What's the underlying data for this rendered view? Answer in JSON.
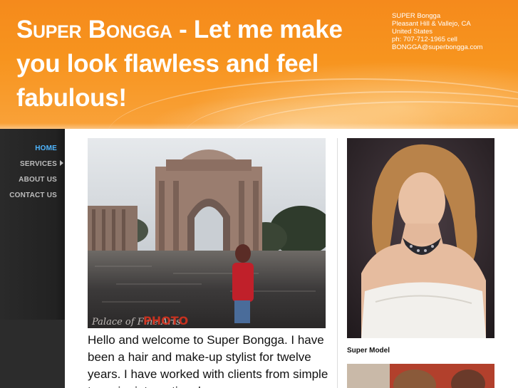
{
  "header": {
    "title_smallcaps": "Super Bongga",
    "title_rest": " - Let me make you look flawless and feel fabulous!",
    "contact": {
      "name": "SUPER Bongga",
      "location": "Pleasant Hill & Vallejo, CA",
      "country": "United States",
      "phone": "ph: 707-712-1965 cell",
      "email": "BONGGA@superbongga.com"
    }
  },
  "nav": {
    "items": [
      {
        "label": "HOME",
        "active": true
      },
      {
        "label": "SERVICES",
        "has_submenu": true
      },
      {
        "label": "ABOUT US"
      },
      {
        "label": "CONTACT US"
      }
    ]
  },
  "main": {
    "photo_watermark": "Palace of Fine Arts",
    "photo_credit": "PHOTO",
    "intro_text": "Hello and welcome to Super Bongga.  I have been a hair and make-up stylist for twelve years.  I have worked with clients from simple to major international"
  },
  "sidebar_right": {
    "caption": "Super Model"
  },
  "colors": {
    "header_orange": "#f7941e",
    "nav_active": "#4fb6ff",
    "nav_text": "#bdbdbd",
    "sidebar_bg": "#222222"
  }
}
